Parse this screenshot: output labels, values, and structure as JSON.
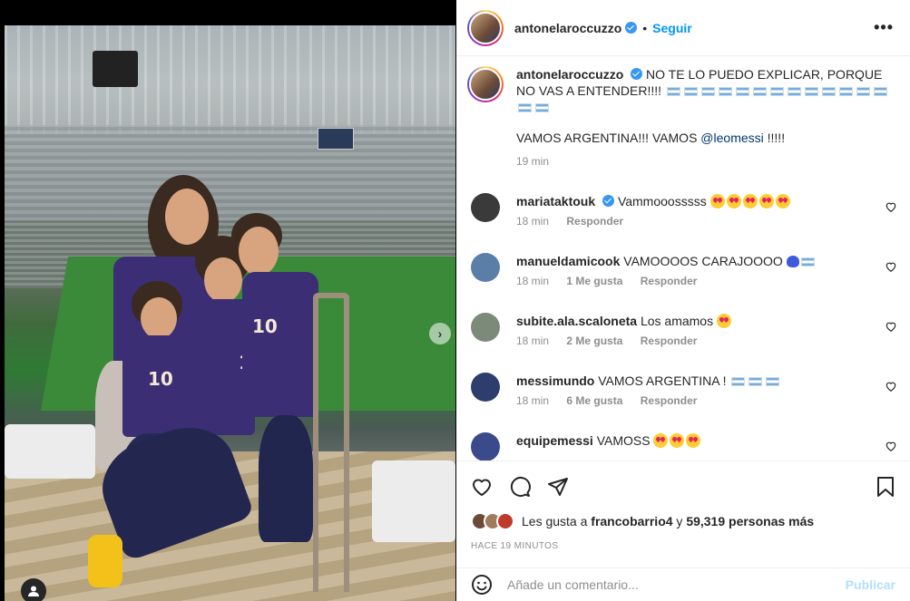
{
  "post": {
    "author": "antonelaroccuzzo",
    "follow_label": "Seguir",
    "dot": "•",
    "more_label": "•••",
    "caption_line1": "NO TE LO PUEDO EXPLICAR, PORQUE NO VAS A ENTENDER!!!!",
    "caption_line2_prefix": "VAMOS ARGENTINA!!! VAMOS",
    "caption_mention": "@leomessi",
    "caption_line2_suffix": "!!!!!",
    "caption_time": "19 min",
    "jersey_numbers": [
      "10",
      "10",
      "10"
    ]
  },
  "comments": [
    {
      "user": "mariataktouk",
      "verified": true,
      "text": "Vammooosssss",
      "emoji": "heart-eyes-x5",
      "time": "18 min",
      "likes": "",
      "reply": "Responder",
      "avatar_color": "#3a3a3a"
    },
    {
      "user": "manueldamicook",
      "verified": false,
      "text": "VAMOOOOS CARAJOOOO",
      "emoji": "blue-heart-flag",
      "time": "18 min",
      "likes": "1 Me gusta",
      "reply": "Responder",
      "avatar_color": "#5a7ea8"
    },
    {
      "user": "subite.ala.scaloneta",
      "verified": false,
      "text": "Los amamos",
      "emoji": "heart-eyes",
      "time": "18 min",
      "likes": "2 Me gusta",
      "reply": "Responder",
      "avatar_color": "#7c8a7a"
    },
    {
      "user": "messimundo",
      "verified": false,
      "text": "VAMOS ARGENTINA !",
      "emoji": "flags-x3",
      "time": "18 min",
      "likes": "6 Me gusta",
      "reply": "Responder",
      "avatar_color": "#2d3e6e"
    },
    {
      "user": "equipemessi",
      "verified": false,
      "text": "VAMOSS",
      "emoji": "heart-eyes-x3",
      "time": "",
      "likes": "",
      "reply": "",
      "avatar_color": "#3b4a8a"
    }
  ],
  "actions": {
    "likes_prefix": "Les gusta a",
    "likes_user": "francobarrio4",
    "likes_middle": "y",
    "likes_count": "59,319 personas más",
    "time_ago": "HACE 19 MINUTOS"
  },
  "add_comment": {
    "placeholder": "Añade un comentario...",
    "publish_label": "Publicar"
  },
  "colors": {
    "follow": "#0095f6",
    "publish_disabled": "#b2dffc",
    "verified": "#3897f0"
  }
}
